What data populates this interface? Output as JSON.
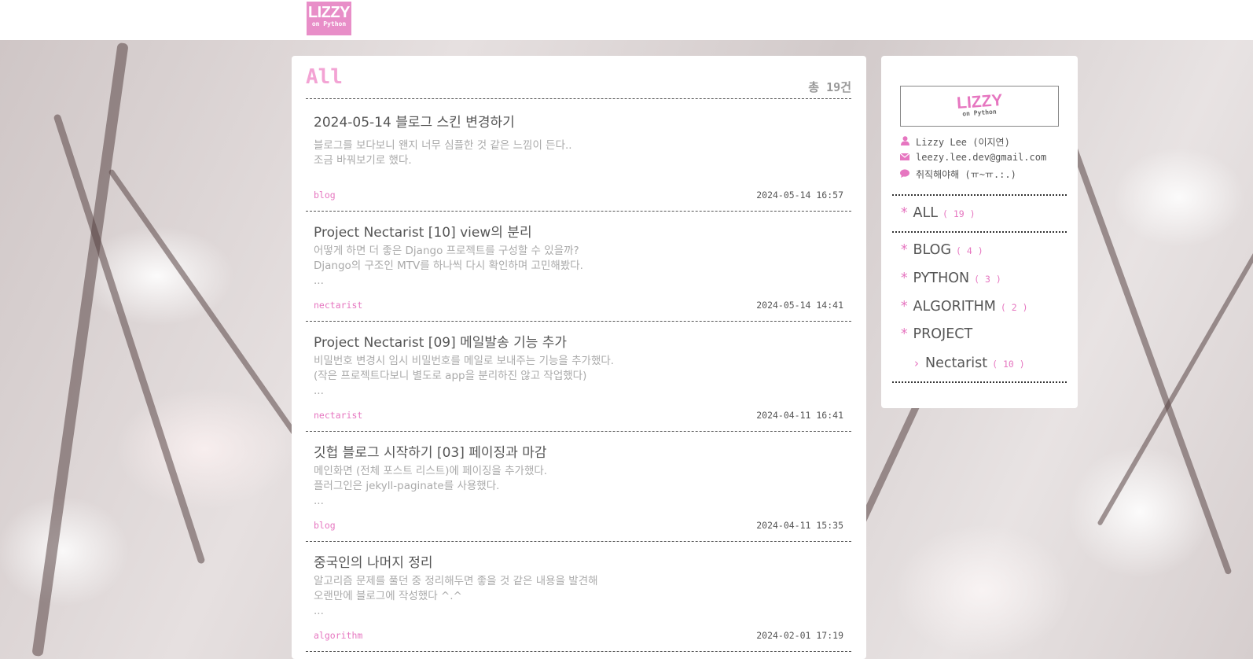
{
  "header": {
    "logo_line1": "LIZZY",
    "logo_line2": "on Python"
  },
  "main": {
    "title": "All",
    "total": "총 19건",
    "posts": [
      {
        "title": "2024-05-14 블로그 스킨 변경하기",
        "excerpt": "블로그를 보다보니 왠지 너무 심플한 것 같은 느낌이 든다..\n조금 바꿔보기로 했다.",
        "tag": "blog",
        "date": "2024-05-14 16:57"
      },
      {
        "title": "Project Nectarist [10] view의 분리",
        "excerpt": "어떻게 하면 더 좋은 Django 프로젝트를 구성할 수 있을까?\nDjango의 구조인 MTV를 하나씩 다시 확인하며 고민해봤다.\n...",
        "tag": "nectarist",
        "date": "2024-05-14 14:41"
      },
      {
        "title": "Project Nectarist [09] 메일발송 기능 추가",
        "excerpt": "비밀번호 변경시 임시 비밀번호를 메일로 보내주는 기능을 추가했다.\n(작은 프로젝트다보니 별도로 app을 분리하진 않고 작업했다)\n...",
        "tag": "nectarist",
        "date": "2024-04-11 16:41"
      },
      {
        "title": "깃헙 블로그 시작하기 [03] 페이징과 마감",
        "excerpt": "메인화면 (전체 포스트 리스트)에 페이징을 추가했다.\n플러그인은 jekyll-paginate를 사용했다.\n...",
        "tag": "blog",
        "date": "2024-04-11 15:35"
      },
      {
        "title": "중국인의 나머지 정리",
        "excerpt": "알고리즘 문제를 풀던 중 정리해두면 좋을 것 같은 내용을 발견해\n오랜만에 블로그에 작성했다 ^.^\n...",
        "tag": "algorithm",
        "date": "2024-02-01 17:19"
      }
    ]
  },
  "sidebar": {
    "logo_line1": "LIZZY",
    "logo_line2": "on Python",
    "profile": {
      "name": "Lizzy Lee (이지연)",
      "email": "leezy.lee.dev@gmail.com",
      "status": "취직해야해 (ㅠ~ㅠ.:.)"
    },
    "all": {
      "label": "ALL",
      "count": "( 19 )"
    },
    "categories": [
      {
        "label": "BLOG",
        "count": "( 4 )"
      },
      {
        "label": "PYTHON",
        "count": "( 3 )"
      },
      {
        "label": "ALGORITHM",
        "count": "( 2 )"
      },
      {
        "label": "PROJECT",
        "count": ""
      }
    ],
    "subcategory": {
      "label": "Nectarist",
      "count": "( 10 )"
    },
    "star": "*",
    "arrow": "›"
  },
  "colors": {
    "accent": "#e676c0",
    "title_pink": "#f3a3d4",
    "logo_bg": "#e88ec8"
  },
  "icons": {
    "name": "user-icon",
    "email": "envelope-icon",
    "status": "chat-bubble-icon"
  }
}
